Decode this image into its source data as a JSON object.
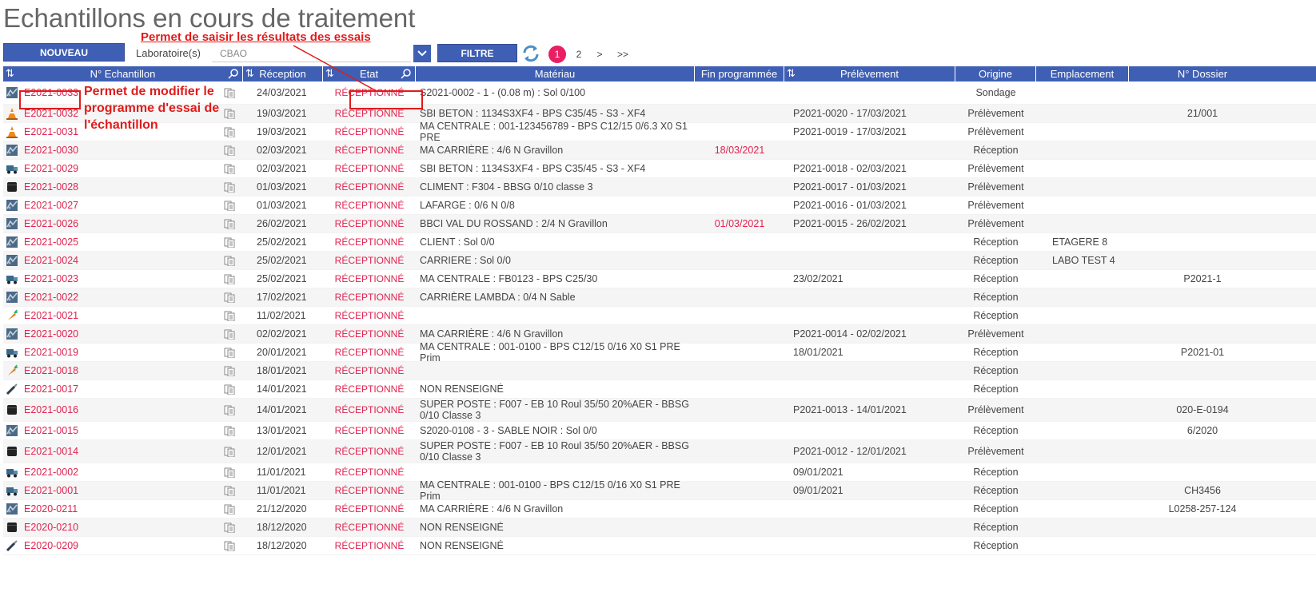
{
  "page": {
    "title": "Echantillons en cours de traitement"
  },
  "toolbar": {
    "new_label": "NOUVEAU",
    "lab_label": "Laboratoire(s)",
    "lab_value": "CBAO",
    "filter_label": "FILTRE",
    "pages": [
      "1",
      "2",
      ">",
      ">>"
    ],
    "active_page": "1"
  },
  "annotations": {
    "top": "Permet de saisir les résultats des essais",
    "side": "Permet de modifier le programme d'essai de l'échantillon"
  },
  "table": {
    "headers": [
      "N° Echantillon",
      "Réception",
      "Etat",
      "Matériau",
      "Fin programmée",
      "Prélèvement",
      "Origine",
      "Emplacement",
      "N° Dossier"
    ],
    "rows": [
      {
        "icon": "aggregate-icon",
        "id": "E2021-0033",
        "reception": "24/03/2021",
        "etat": "RÉCEPTIONNÉ",
        "materiau": "S2021-0002 - 1 - (0.08 m) : Sol 0/100",
        "fin": "",
        "prelevement": "",
        "origine": "Sondage",
        "emplacement": "",
        "dossier": ""
      },
      {
        "icon": "cone-icon",
        "id": "E2021-0032",
        "reception": "19/03/2021",
        "etat": "RÉCEPTIONNÉ",
        "materiau": "SBI BETON : 1134S3XF4 - BPS C35/45 - S3 - XF4",
        "fin": "",
        "prelevement": "P2021-0020 - 17/03/2021",
        "origine": "Prélèvement",
        "emplacement": "",
        "dossier": "21/001"
      },
      {
        "icon": "cone-icon",
        "id": "E2021-0031",
        "reception": "19/03/2021",
        "etat": "RÉCEPTIONNÉ",
        "materiau": "MA CENTRALE : 001-123456789 - BPS C12/15 0/6.3 X0 S1 PRE",
        "fin": "",
        "prelevement": "P2021-0019 - 17/03/2021",
        "origine": "Prélèvement",
        "emplacement": "",
        "dossier": ""
      },
      {
        "icon": "aggregate-icon",
        "id": "E2021-0030",
        "reception": "02/03/2021",
        "etat": "RÉCEPTIONNÉ",
        "materiau": "MA CARRIÈRE : 4/6 N Gravillon",
        "fin": "18/03/2021",
        "prelevement": "",
        "origine": "Réception",
        "emplacement": "",
        "dossier": ""
      },
      {
        "icon": "truck-icon",
        "id": "E2021-0029",
        "reception": "02/03/2021",
        "etat": "RÉCEPTIONNÉ",
        "materiau": "SBI BETON : 1134S3XF4 - BPS C35/45 - S3 - XF4",
        "fin": "",
        "prelevement": "P2021-0018 - 02/03/2021",
        "origine": "Prélèvement",
        "emplacement": "",
        "dossier": ""
      },
      {
        "icon": "barrel-icon",
        "id": "E2021-0028",
        "reception": "01/03/2021",
        "etat": "RÉCEPTIONNÉ",
        "materiau": "CLIMENT : F304 - BBSG 0/10 classe 3",
        "fin": "",
        "prelevement": "P2021-0017 - 01/03/2021",
        "origine": "Prélèvement",
        "emplacement": "",
        "dossier": ""
      },
      {
        "icon": "aggregate-icon",
        "id": "E2021-0027",
        "reception": "01/03/2021",
        "etat": "RÉCEPTIONNÉ",
        "materiau": "LAFARGE : 0/6 N 0/8",
        "fin": "",
        "prelevement": "P2021-0016 - 01/03/2021",
        "origine": "Prélèvement",
        "emplacement": "",
        "dossier": ""
      },
      {
        "icon": "aggregate-icon",
        "id": "E2021-0026",
        "reception": "26/02/2021",
        "etat": "RÉCEPTIONNÉ",
        "materiau": "BBCI VAL DU ROSSAND : 2/4 N Gravillon",
        "fin": "01/03/2021",
        "prelevement": "P2021-0015 - 26/02/2021",
        "origine": "Prélèvement",
        "emplacement": "",
        "dossier": ""
      },
      {
        "icon": "aggregate-icon",
        "id": "E2021-0025",
        "reception": "25/02/2021",
        "etat": "RÉCEPTIONNÉ",
        "materiau": "CLIENT : Sol 0/0",
        "fin": "",
        "prelevement": "",
        "origine": "Réception",
        "emplacement": "ETAGERE 8",
        "dossier": ""
      },
      {
        "icon": "aggregate-icon",
        "id": "E2021-0024",
        "reception": "25/02/2021",
        "etat": "RÉCEPTIONNÉ",
        "materiau": "CARRIERE : Sol 0/0",
        "fin": "",
        "prelevement": "",
        "origine": "Réception",
        "emplacement": "LABO TEST 4",
        "dossier": ""
      },
      {
        "icon": "truck-icon",
        "id": "E2021-0023",
        "reception": "25/02/2021",
        "etat": "RÉCEPTIONNÉ",
        "materiau": "MA CENTRALE : FB0123 - BPS C25/30",
        "fin": "",
        "prelevement": "23/02/2021",
        "origine": "Réception",
        "emplacement": "",
        "dossier": "P2021-1"
      },
      {
        "icon": "aggregate-icon",
        "id": "E2021-0022",
        "reception": "17/02/2021",
        "etat": "RÉCEPTIONNÉ",
        "materiau": "CARRIÈRE LAMBDA : 0/4 N Sable",
        "fin": "",
        "prelevement": "",
        "origine": "Réception",
        "emplacement": "",
        "dossier": ""
      },
      {
        "icon": "carrot-icon",
        "id": "E2021-0021",
        "reception": "11/02/2021",
        "etat": "RÉCEPTIONNÉ",
        "materiau": "",
        "fin": "",
        "prelevement": "",
        "origine": "Réception",
        "emplacement": "",
        "dossier": ""
      },
      {
        "icon": "aggregate-icon",
        "id": "E2021-0020",
        "reception": "02/02/2021",
        "etat": "RÉCEPTIONNÉ",
        "materiau": "MA CARRIÈRE : 4/6 N Gravillon",
        "fin": "",
        "prelevement": "P2021-0014 - 02/02/2021",
        "origine": "Prélèvement",
        "emplacement": "",
        "dossier": ""
      },
      {
        "icon": "truck-icon",
        "id": "E2021-0019",
        "reception": "20/01/2021",
        "etat": "RÉCEPTIONNÉ",
        "materiau": "MA CENTRALE : 001-0100 - BPS C12/15 0/16 X0 S1 PRE Prim",
        "fin": "",
        "prelevement": "18/01/2021",
        "origine": "Réception",
        "emplacement": "",
        "dossier": "P2021-01"
      },
      {
        "icon": "carrot-icon",
        "id": "E2021-0018",
        "reception": "18/01/2021",
        "etat": "RÉCEPTIONNÉ",
        "materiau": "",
        "fin": "",
        "prelevement": "",
        "origine": "Réception",
        "emplacement": "",
        "dossier": ""
      },
      {
        "icon": "brush-icon",
        "id": "E2021-0017",
        "reception": "14/01/2021",
        "etat": "RÉCEPTIONNÉ",
        "materiau": "NON RENSEIGNÉ",
        "fin": "",
        "prelevement": "",
        "origine": "Réception",
        "emplacement": "",
        "dossier": ""
      },
      {
        "icon": "barrel-icon",
        "id": "E2021-0016",
        "reception": "14/01/2021",
        "etat": "RÉCEPTIONNÉ",
        "materiau": "SUPER POSTE : F007 - EB 10 Roul 35/50 20%AER - BBSG 0/10 Classe 3",
        "fin": "",
        "prelevement": "P2021-0013 - 14/01/2021",
        "origine": "Prélèvement",
        "emplacement": "",
        "dossier": "020-E-0194"
      },
      {
        "icon": "aggregate-icon",
        "id": "E2021-0015",
        "reception": "13/01/2021",
        "etat": "RÉCEPTIONNÉ",
        "materiau": "S2020-0108 - 3 - SABLE NOIR : Sol 0/0",
        "fin": "",
        "prelevement": "",
        "origine": "Réception",
        "emplacement": "",
        "dossier": "6/2020"
      },
      {
        "icon": "barrel-icon",
        "id": "E2021-0014",
        "reception": "12/01/2021",
        "etat": "RÉCEPTIONNÉ",
        "materiau": "SUPER POSTE : F007 - EB 10 Roul 35/50 20%AER - BBSG 0/10 Classe 3",
        "fin": "",
        "prelevement": "P2021-0012 - 12/01/2021",
        "origine": "Prélèvement",
        "emplacement": "",
        "dossier": ""
      },
      {
        "icon": "truck-icon",
        "id": "E2021-0002",
        "reception": "11/01/2021",
        "etat": "RÉCEPTIONNÉ",
        "materiau": "",
        "fin": "",
        "prelevement": "09/01/2021",
        "origine": "Réception",
        "emplacement": "",
        "dossier": ""
      },
      {
        "icon": "truck-icon",
        "id": "E2021-0001",
        "reception": "11/01/2021",
        "etat": "RÉCEPTIONNÉ",
        "materiau": "MA CENTRALE : 001-0100 - BPS C12/15 0/16 X0 S1 PRE Prim",
        "fin": "",
        "prelevement": "09/01/2021",
        "origine": "Réception",
        "emplacement": "",
        "dossier": "CH3456"
      },
      {
        "icon": "aggregate-icon",
        "id": "E2020-0211",
        "reception": "21/12/2020",
        "etat": "RÉCEPTIONNÉ",
        "materiau": "MA CARRIÈRE : 4/6 N Gravillon",
        "fin": "",
        "prelevement": "",
        "origine": "Réception",
        "emplacement": "",
        "dossier": "L0258-257-124"
      },
      {
        "icon": "barrel-icon",
        "id": "E2020-0210",
        "reception": "18/12/2020",
        "etat": "RÉCEPTIONNÉ",
        "materiau": "NON RENSEIGNÉ",
        "fin": "",
        "prelevement": "",
        "origine": "Réception",
        "emplacement": "",
        "dossier": ""
      },
      {
        "icon": "brush-icon",
        "id": "E2020-0209",
        "reception": "18/12/2020",
        "etat": "RÉCEPTIONNÉ",
        "materiau": "NON RENSEIGNÉ",
        "fin": "",
        "prelevement": "",
        "origine": "Réception",
        "emplacement": "",
        "dossier": ""
      }
    ]
  },
  "colors": {
    "header_blue": "#3f5fb4",
    "link_red": "#e0234f",
    "annotation_red": "#e01b1b",
    "page_pink": "#e91e63"
  }
}
